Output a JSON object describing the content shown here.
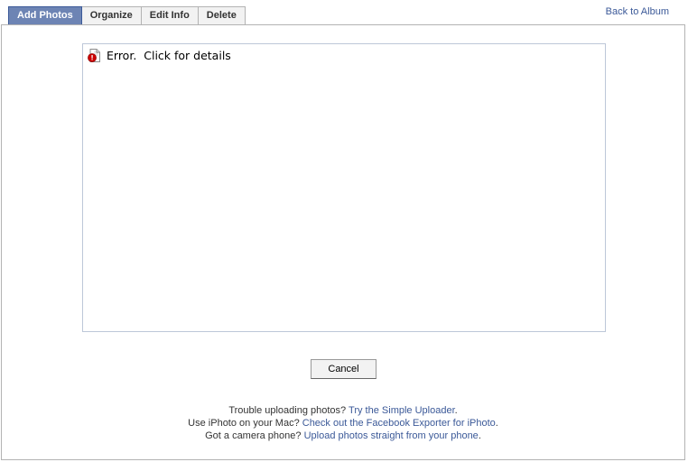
{
  "tabs": [
    {
      "label": "Add Photos",
      "active": true
    },
    {
      "label": "Organize",
      "active": false
    },
    {
      "label": "Edit Info",
      "active": false
    },
    {
      "label": "Delete",
      "active": false
    }
  ],
  "back_link": "Back to Album",
  "uploader": {
    "error_text": "Error.  Click for details",
    "error_icon": "error-document-icon"
  },
  "cancel_label": "Cancel",
  "help": {
    "line1_text": "Trouble uploading photos? ",
    "line1_link": "Try the Simple Uploader",
    "line1_end": ".",
    "line2_text": "Use iPhoto on your Mac? ",
    "line2_link": "Check out the Facebook Exporter for iPhoto",
    "line2_end": ".",
    "line3_text": "Got a camera phone? ",
    "line3_link": "Upload photos straight from your phone",
    "line3_end": "."
  },
  "colors": {
    "accent": "#3b5998",
    "active_tab": "#6d84b4",
    "error_red": "#cc0000"
  }
}
